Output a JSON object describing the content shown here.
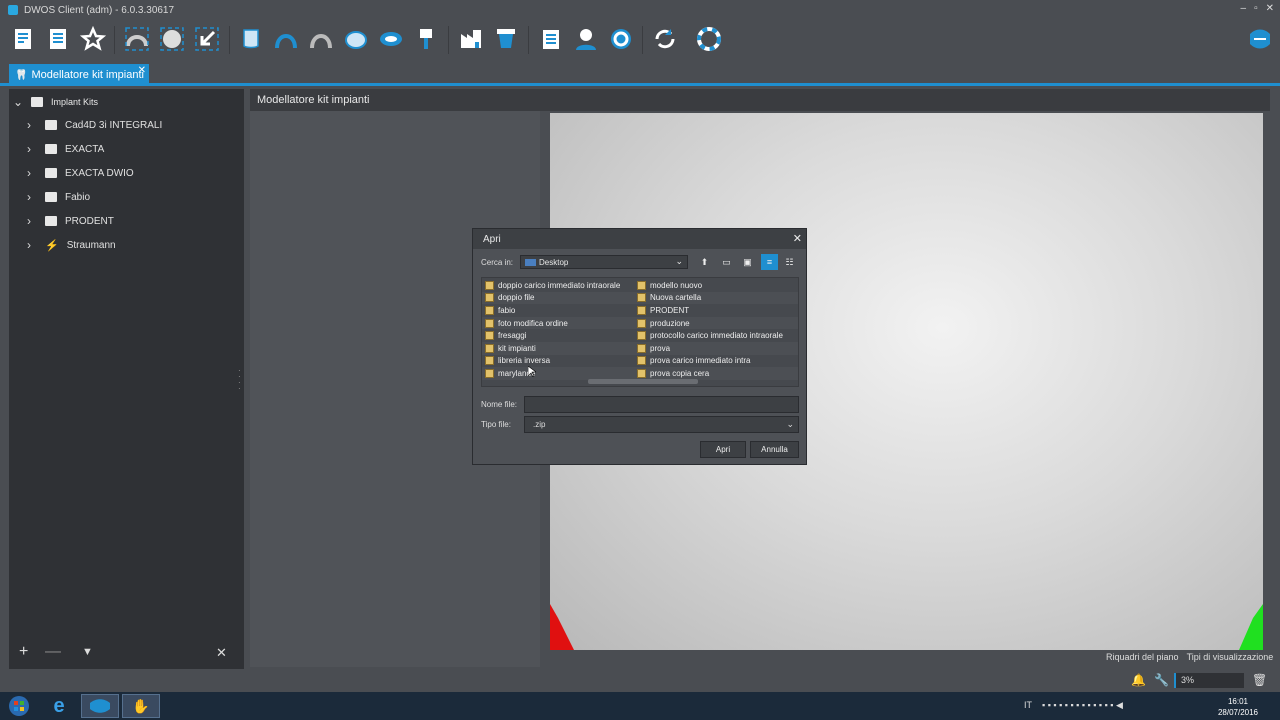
{
  "window": {
    "title": "DWOS Client (adm) - 6.0.3.30617",
    "controls": [
      "–",
      "▫",
      "✕"
    ]
  },
  "toolbar": {
    "icons": [
      "new-order-icon",
      "order-list-icon",
      "favorites-icon",
      "scan-arch-icon",
      "scan-dots-icon",
      "import-icon",
      "tooth-icon",
      "crown-icon",
      "bridge-icon",
      "abutment-icon",
      "implant-model-icon",
      "implant-icon",
      "lab-icon",
      "manufacturing-icon",
      "clipboard-icon",
      "user-icon",
      "settings-icon",
      "sync-icon",
      "help-icon"
    ],
    "brand_icon": "dental-wings-logo-icon"
  },
  "tab": {
    "label": "Modellatore kit impianti",
    "close": "✕"
  },
  "sidebar": {
    "root_label": "Implant Kits",
    "items": [
      {
        "label": "Cad4D 3i INTEGRALI",
        "icon": "folder-icon"
      },
      {
        "label": "EXACTA",
        "icon": "folder-icon"
      },
      {
        "label": "EXACTA DWIO",
        "icon": "folder-icon"
      },
      {
        "label": "Fabio",
        "icon": "folder-icon"
      },
      {
        "label": "PRODENT",
        "icon": "folder-icon"
      },
      {
        "label": "Straumann",
        "icon": "straumann-icon"
      }
    ],
    "bottom": {
      "add": "+",
      "remove": "—",
      "filter": "▼",
      "clear": "✕"
    }
  },
  "main": {
    "header": "Modellatore kit impianti"
  },
  "viewport": {
    "status_links": [
      "Riquadri del piano",
      "Tipi di visualizzazione"
    ],
    "colors": {
      "red_axis": "#e01010",
      "green_axis": "#20e020"
    }
  },
  "bottom_strip": {
    "zoom": "3%"
  },
  "dialog": {
    "title": "Apri",
    "close": "✕",
    "look_in_label": "Cerca in:",
    "look_in_value": "Desktop",
    "files_left": [
      "doppio carico immediato intraorale",
      "doppio file",
      "fabio",
      "foto modifica ordine",
      "fresaggi",
      "kit impianti",
      "libreria inversa",
      "marylande"
    ],
    "files_right": [
      "modello nuovo",
      "Nuova cartella",
      "PRODENT",
      "produzione",
      "protocollo carico immediato intraorale",
      "prova",
      "prova carico immediato intra",
      "prova copia cera"
    ],
    "filename_label": "Nome file:",
    "filename_value": "",
    "filetype_label": "Tipo file:",
    "filetype_value": ".zip",
    "open_button": "Apri",
    "cancel_button": "Annulla"
  },
  "taskbar": {
    "language": "IT",
    "time": "16:01",
    "date": "28/07/2016"
  }
}
